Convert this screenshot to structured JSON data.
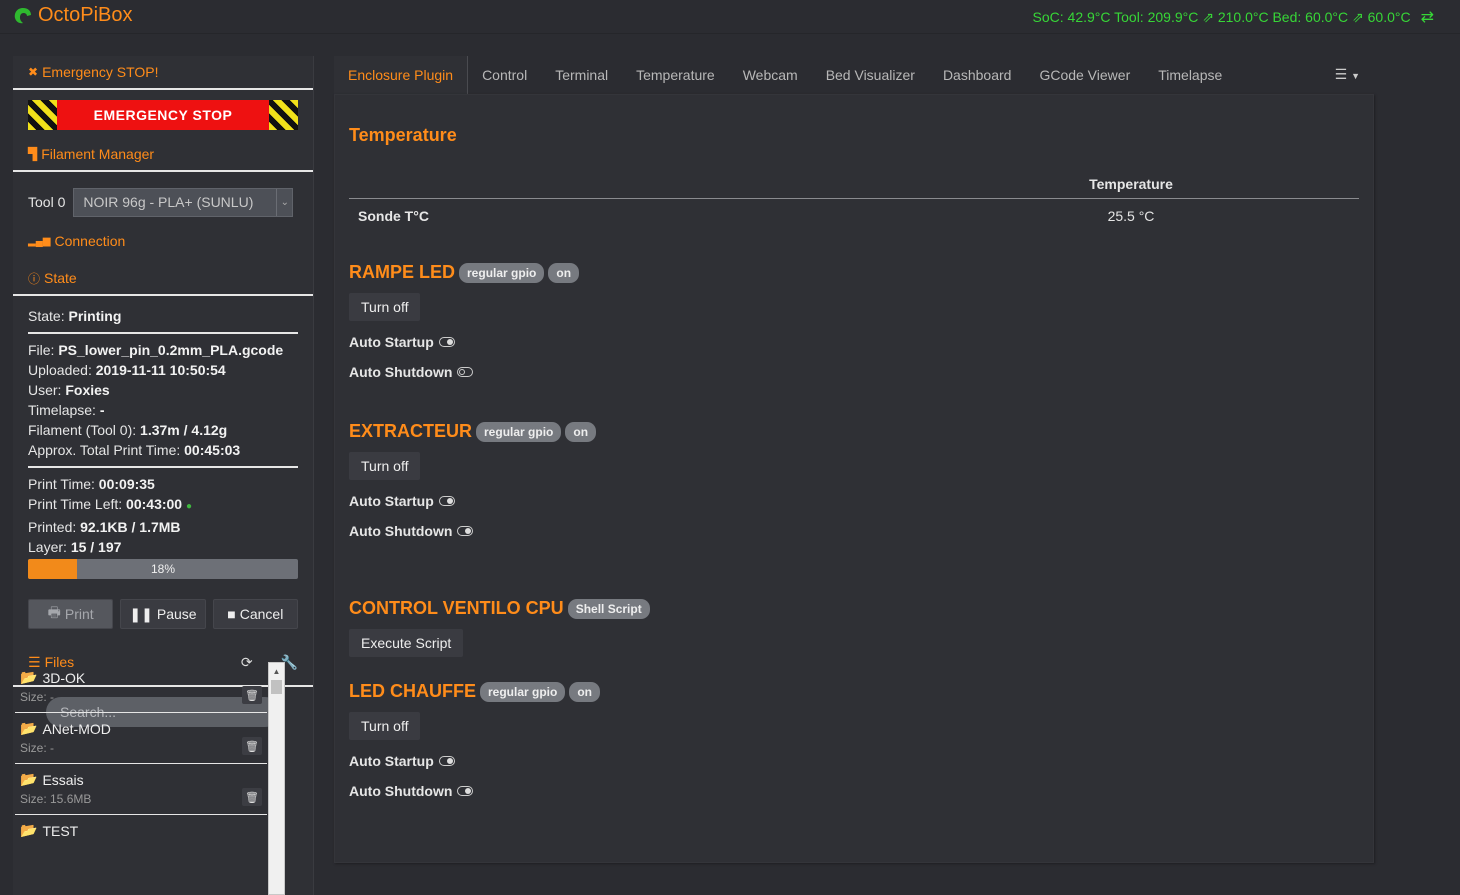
{
  "app": {
    "brand": "OctoPiBox"
  },
  "navbar": {
    "status_text": "SoC: 42.9°C Tool: 209.9°C ⇗ 210.0°C Bed: 60.0°C ⇗ 60.0°C",
    "connection_icon": "⇄"
  },
  "sidebar": {
    "emergency_title": "Emergency STOP!",
    "emergency_button": "EMERGENCY STOP",
    "filament_title": "Filament Manager",
    "tool_label": "Tool 0",
    "tool_selected": "NOIR 96g - PLA+ (SUNLU)",
    "connection_title": "Connection",
    "state_title": "State",
    "state": {
      "state_label": "State:",
      "state_value": "Printing",
      "file_label": "File:",
      "file_value": "PS_lower_pin_0.2mm_PLA.gcode",
      "uploaded_label": "Uploaded:",
      "uploaded_value": "2019-11-11 10:50:54",
      "user_label": "User:",
      "user_value": "Foxies",
      "timelapse_label": "Timelapse:",
      "timelapse_value": "-",
      "filament_label": "Filament (Tool 0):",
      "filament_value": "1.37m / 4.12g",
      "approx_label": "Approx. Total Print Time:",
      "approx_value": "00:45:03",
      "print_time_label": "Print Time:",
      "print_time_value": "00:09:35",
      "time_left_label": "Print Time Left:",
      "time_left_value": "00:43:00",
      "printed_label": "Printed:",
      "printed_value": "92.1KB / 1.7MB",
      "layer_label": "Layer:",
      "layer_value": "15 / 197",
      "progress_label": "18%",
      "progress": 0.18
    },
    "buttons": {
      "print": "Print",
      "pause": "Pause",
      "cancel": "Cancel"
    },
    "files_title": "Files",
    "search_placeholder": "Search...",
    "files": [
      {
        "name": "3D-OK",
        "size": "Size: -"
      },
      {
        "name": "ANet-MOD",
        "size": "Size: -"
      },
      {
        "name": "Essais",
        "size": "Size: 15.6MB"
      },
      {
        "name": "TEST",
        "size": ""
      }
    ]
  },
  "tabs": [
    "Enclosure Plugin",
    "Control",
    "Terminal",
    "Temperature",
    "Webcam",
    "Bed Visualizer",
    "Dashboard",
    "GCode Viewer",
    "Timelapse"
  ],
  "enclosure": {
    "temp_title": "Temperature",
    "temp_col_header": "Temperature",
    "sensor_label": "Sonde T°C",
    "sensor_value": "25.5 °C",
    "devices": [
      {
        "title": "RAMPE LED",
        "badges": [
          "regular gpio",
          "on"
        ],
        "button": "Turn off",
        "startup_label": "Auto Startup",
        "shutdown_label": "Auto Shutdown"
      },
      {
        "title": "EXTRACTEUR",
        "badges": [
          "regular gpio",
          "on"
        ],
        "button": "Turn off",
        "startup_label": "Auto Startup",
        "shutdown_label": "Auto Shutdown"
      },
      {
        "title": "CONTROL VENTILO CPU",
        "badges": [
          "Shell Script"
        ],
        "button": "Execute Script"
      },
      {
        "title": "LED CHAUFFE",
        "badges": [
          "regular gpio",
          "on"
        ],
        "button": "Turn off",
        "startup_label": "Auto Startup",
        "shutdown_label": "Auto Shutdown"
      }
    ]
  },
  "colors": {
    "accent": "#ff8c1a",
    "status_green": "#37d637",
    "estop_red": "#ee1111"
  }
}
